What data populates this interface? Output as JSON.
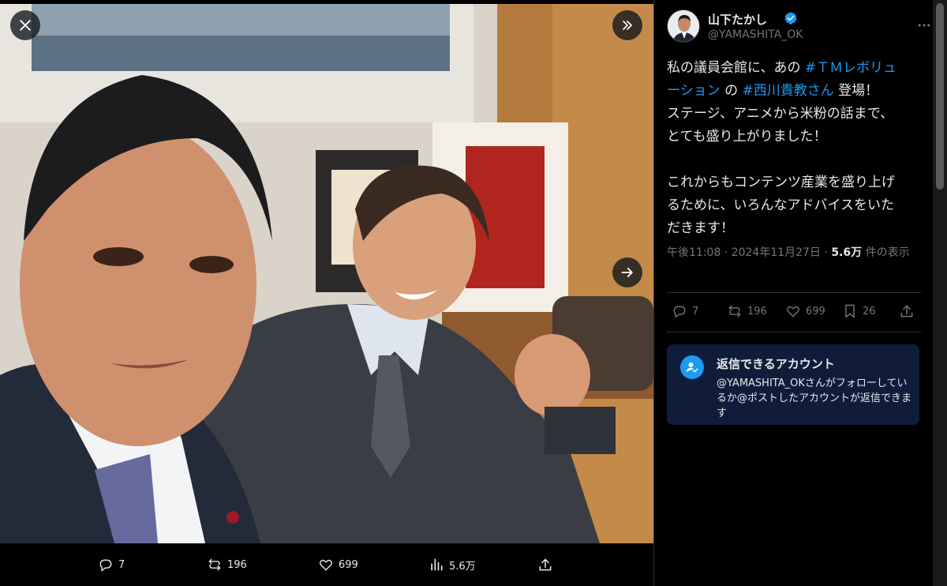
{
  "viewer": {
    "actions": {
      "reply_count": "7",
      "repost_count": "196",
      "like_count": "699",
      "view_count": "5.6万"
    }
  },
  "post": {
    "author_name": "山下たかし",
    "author_handle": "@YAMASHITA_OK",
    "text": {
      "l1": "私の議員会館に、あの ",
      "tag1": "#ＴＭレボリュ",
      "tag1b": "ーション",
      "l2_mid": " の ",
      "tag2": "#西川貴教さん",
      "l2_end": " 登場！",
      "l3": "ステージ、アニメから米粉の話まで、",
      "l4": "とても盛り上がりました！",
      "l5": "これからもコンテンツ産業を盛り上げ",
      "l6": "るために、いろんなアドバイスをいた",
      "l7": "だきます！"
    },
    "timestamp": "午後11:08 · 2024年11月27日 · ",
    "views_value": "5.6万",
    "views_suffix": " 件の表示",
    "actions": {
      "reply_count": "7",
      "repost_count": "196",
      "like_count": "699",
      "bookmark_count": "26"
    },
    "reply_restriction": {
      "title": "返信できるアカウント",
      "body": "@YAMASHITA_OKさんがフォローしているか@ポストしたアカウントが返信できます"
    }
  },
  "colors": {
    "accent": "#1d9bf0",
    "background": "#000000",
    "muted": "#71767b",
    "reply_box": "#0f1d3b"
  },
  "icons": [
    "close-icon",
    "expand-icon",
    "next-arrow-icon",
    "reply-icon",
    "repost-icon",
    "like-icon",
    "views-icon",
    "share-icon",
    "bookmark-icon",
    "more-icon",
    "verified-icon",
    "user-check-icon"
  ]
}
